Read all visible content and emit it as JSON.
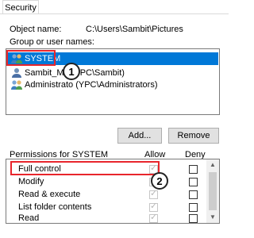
{
  "tabs": [
    {
      "label": "Security"
    }
  ],
  "object_name": {
    "label": "Object name:",
    "value": "C:\\Users\\Sambit\\Pictures"
  },
  "group_label": "Group or user names:",
  "users": [
    {
      "label": "SYSTEM",
      "selected": true
    },
    {
      "label": "Sambit_Ma (YPC\\Sambit)",
      "selected": false
    },
    {
      "label": "Administrato (YPC\\Administrators)",
      "selected": false
    }
  ],
  "buttons": {
    "add": "Add...",
    "remove": "Remove"
  },
  "permissions": {
    "header": "Permissions for SYSTEM",
    "allow_label": "Allow",
    "deny_label": "Deny",
    "rows": [
      {
        "label": "Full control",
        "allow": true,
        "deny": false
      },
      {
        "label": "Modify",
        "allow": true,
        "deny": false
      },
      {
        "label": "Read & execute",
        "allow": true,
        "deny": false
      },
      {
        "label": "List folder contents",
        "allow": true,
        "deny": false
      },
      {
        "label": "Read",
        "allow": true,
        "deny": false
      }
    ]
  },
  "callouts": [
    {
      "number": "1"
    },
    {
      "number": "2"
    }
  ],
  "colors": {
    "selection": "#0078d7",
    "callout": "#e8252c",
    "background": "#ffffff"
  }
}
